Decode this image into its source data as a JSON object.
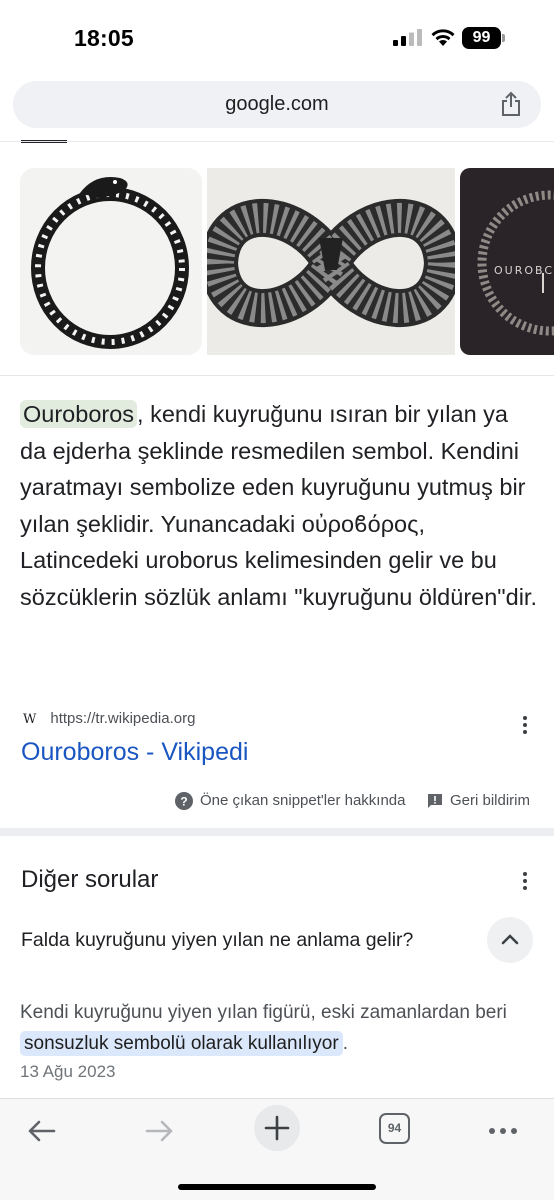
{
  "status_bar": {
    "time": "18:05",
    "battery": "99"
  },
  "url_bar": {
    "url": "google.com",
    "share_icon": "share-icon"
  },
  "snippet": {
    "highlight": "Ouroboros",
    "text": ", kendi kuyruğunu ısıran bir yılan ya da ejderha şeklinde resmedilen sembol. Kendini yaratmayı sembolize eden kuyruğunu yutmuş bir yılan şeklidir. Yunancadaki οὐροϐόρος, Latincedeki uroborus kelimesinden gelir ve bu sözcüklerin sözlük anlamı \"kuyruğunu öldüren\"dir."
  },
  "source": {
    "favicon": "W",
    "url": "https://tr.wikipedia.org"
  },
  "result": {
    "title": "Ouroboros - Vikipedi"
  },
  "feedback": {
    "about": "Öne çıkan snippet'ler hakkında",
    "report": "Geri bildirim"
  },
  "other_questions": {
    "title": "Diğer sorular",
    "question": "Falda kuyruğunu yiyen yılan ne anlama gelir?",
    "answer_before": "Kendi kuyruğunu yiyen yılan figürü, eski zamanlardan beri ",
    "answer_highlight": "sonsuzluk sembolü olarak kullanılıyor",
    "answer_after": ".",
    "date": "13 Ağu 2023"
  },
  "images": {
    "third_caption": "OUROBC"
  },
  "toolbar": {
    "tab_count": "94"
  }
}
